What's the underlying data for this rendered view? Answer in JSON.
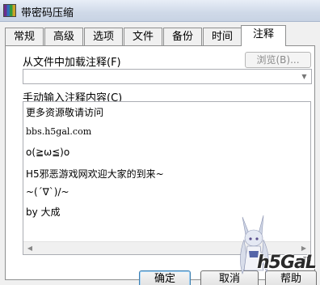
{
  "window": {
    "title": "带密码压缩"
  },
  "tabs": [
    {
      "label": "常规"
    },
    {
      "label": "高级"
    },
    {
      "label": "选项"
    },
    {
      "label": "文件"
    },
    {
      "label": "备份"
    },
    {
      "label": "时间"
    },
    {
      "label": "注释",
      "active": true
    }
  ],
  "load_from_file": {
    "label": "从文件中加载注释(F)",
    "browse_label": "浏览(B)...",
    "file_value": ""
  },
  "manual": {
    "label": "手动输入注释内容(C)",
    "lines": [
      "更多资源敬请访问",
      "bbs.h5gal.com",
      "o(≧ω≦)o",
      "H5邪恶游戏网欢迎大家的到来~",
      "~(´∇`)/~",
      "by 大成"
    ]
  },
  "watermark": {
    "brand": "h5GaL",
    "tm": "TM"
  },
  "buttons": {
    "ok": "确定",
    "cancel": "取消",
    "help": "帮助"
  }
}
